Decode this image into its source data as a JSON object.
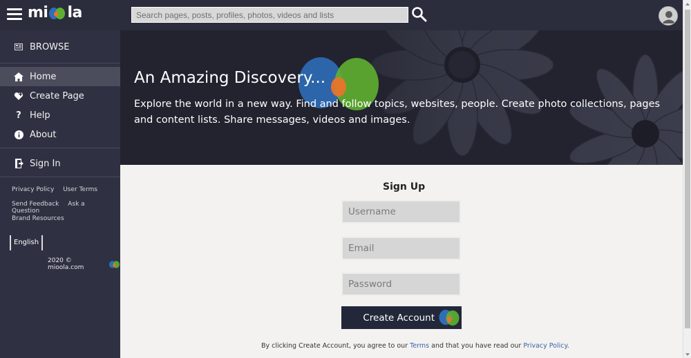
{
  "header": {
    "logo_text": "miola",
    "search_placeholder": "Search pages, posts, profiles, photos, videos and lists"
  },
  "sidebar": {
    "browse_label": "BROWSE",
    "items": [
      {
        "label": "Home",
        "icon": "home-icon"
      },
      {
        "label": "Create Page",
        "icon": "heart-add-icon"
      },
      {
        "label": "Help",
        "icon": "question-icon"
      },
      {
        "label": "About",
        "icon": "info-icon"
      }
    ],
    "signin_label": "Sign In",
    "links": {
      "privacy": "Privacy Policy",
      "terms": "User Terms",
      "feedback": "Send Feedback",
      "question": "Ask a Question",
      "brand": "Brand Resources"
    },
    "language": "English",
    "copyright": "2020 © mioola.com"
  },
  "hero": {
    "title": "An Amazing Discovery...",
    "text": "Explore the world in a new way. Find and follow topics, websites, people. Create photo collections, pages and content lists. Share messages, videos and images."
  },
  "signup": {
    "title": "Sign Up",
    "username_placeholder": "Username",
    "email_placeholder": "Email",
    "password_placeholder": "Password",
    "create_label": "Create Account",
    "agree_prefix": "By clicking Create Account, you agree to our",
    "terms_link": "Terms",
    "agree_middle": "and that you have read our",
    "privacy_link": "Privacy Policy",
    "agree_suffix": "."
  },
  "colors": {
    "topbar": "#2b2d3c",
    "sidebar": "#2f3142",
    "sidebar_active": "#4b4d5c",
    "button": "#22283a",
    "link": "#3b63a8",
    "logo_blue": "#2f6db8",
    "logo_green": "#5fb030",
    "logo_orange": "#e8742a"
  }
}
